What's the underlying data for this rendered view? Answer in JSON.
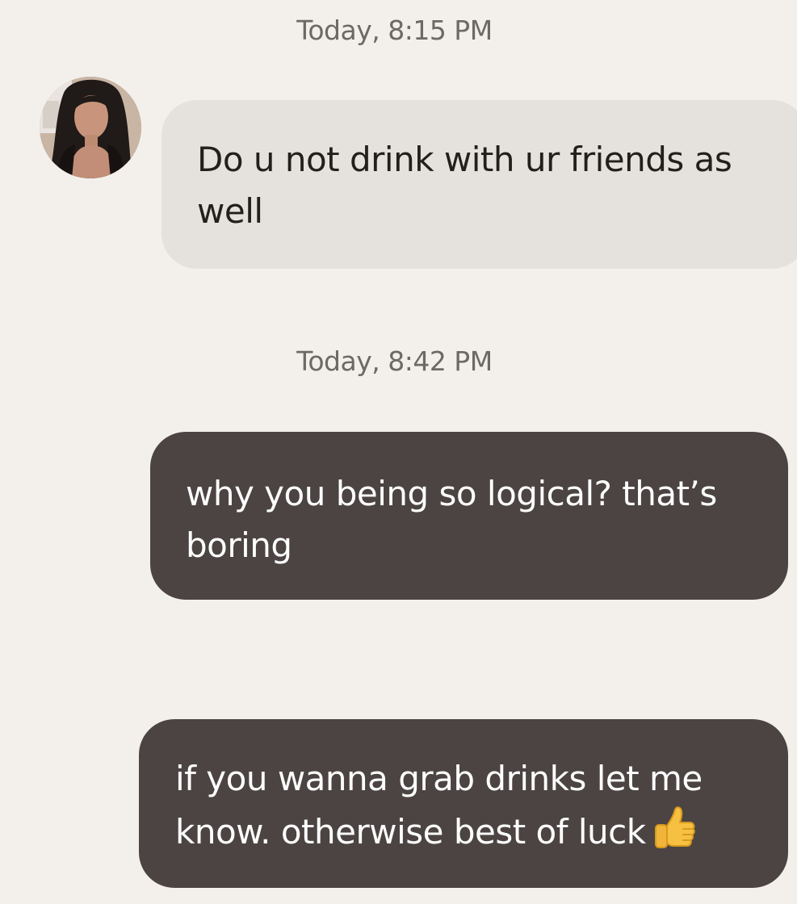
{
  "conversation": {
    "messages": [
      {
        "timestamp": "Today, 8:15 PM",
        "direction": "incoming",
        "text": "Do u not drink with ur friends as well",
        "avatar_icon": "contact-photo"
      },
      {
        "timestamp": "Today, 8:42 PM",
        "direction": "outgoing",
        "text": "why you being so logical? that’s boring"
      },
      {
        "direction": "outgoing",
        "text": "if you wanna grab drinks let me know. otherwise best of luck",
        "emoji": "thumbs-up-icon"
      }
    ]
  },
  "colors": {
    "background": "#f3f0ec",
    "incoming_bubble": "#e5e1dc",
    "outgoing_bubble": "#4b4443",
    "timestamp_text": "#6d6965"
  }
}
